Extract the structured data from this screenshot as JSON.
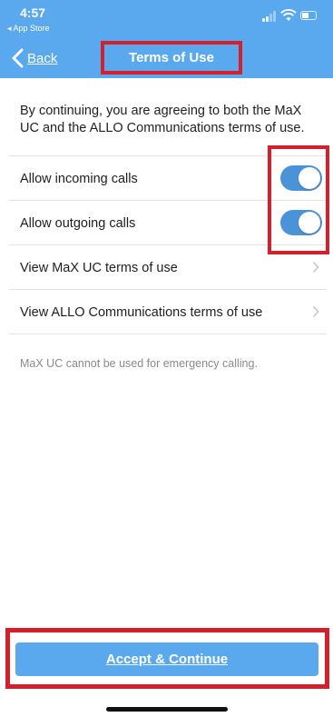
{
  "status_bar": {
    "time": "4:57",
    "back_app_label": "◂ App Store"
  },
  "nav": {
    "back_label": "Back",
    "title": "Terms of Use"
  },
  "intro_text": "By continuing, you are agreeing to both the MaX UC and the ALLO Communications terms of use.",
  "settings": [
    {
      "label": "Allow incoming calls",
      "toggle_on": true
    },
    {
      "label": "Allow outgoing calls",
      "toggle_on": true
    }
  ],
  "links": [
    {
      "label": "View MaX UC terms of use"
    },
    {
      "label": "View ALLO Communications terms of use"
    }
  ],
  "footnote": "MaX UC cannot be used for emergency calling.",
  "accept_button_label": "Accept & Continue",
  "colors": {
    "header": "#5aa9ee",
    "toggle_on": "#4b93d8",
    "highlight": "#d51f2a"
  }
}
